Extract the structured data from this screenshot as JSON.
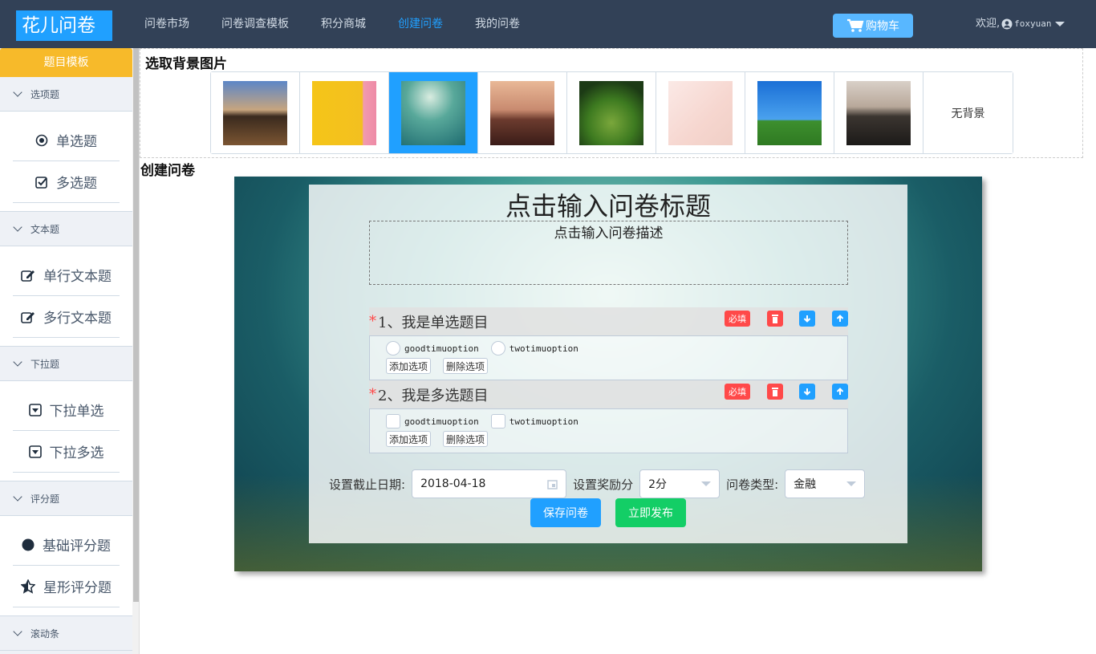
{
  "brand": "花儿问卷",
  "nav": [
    "问卷市场",
    "问卷调查模板",
    "积分商城",
    "创建问卷",
    "我的问卷"
  ],
  "nav_active": "创建问卷",
  "cart_label": "购物车",
  "welcome": "欢迎,",
  "username": "foxyuan",
  "sidebar": {
    "template_button": "题目模板",
    "groups": [
      {
        "title": "选项题",
        "items": [
          {
            "icon": "radio-icon",
            "label": "单选题"
          },
          {
            "icon": "checkbox-icon",
            "label": "多选题"
          }
        ]
      },
      {
        "title": "文本题",
        "items": [
          {
            "icon": "edit-icon",
            "label": "单行文本题"
          },
          {
            "icon": "edit-icon",
            "label": "多行文本题"
          }
        ]
      },
      {
        "title": "下拉题",
        "items": [
          {
            "icon": "dropdown-icon",
            "label": "下拉单选"
          },
          {
            "icon": "dropdown-icon",
            "label": "下拉多选"
          }
        ]
      },
      {
        "title": "评分题",
        "items": [
          {
            "icon": "circle-icon",
            "label": "基础评分题"
          },
          {
            "icon": "star-icon",
            "label": "星形评分题"
          }
        ]
      },
      {
        "title": "滚动条",
        "items": []
      }
    ]
  },
  "bg_section": {
    "heading": "选取背景图片",
    "selected_index": 2,
    "no_bg_label": "无背景"
  },
  "create_section": {
    "heading": "创建问卷",
    "title_placeholder": "点击输入问卷标题",
    "desc_placeholder": "点击输入问卷描述",
    "questions": [
      {
        "number": "1",
        "text": "1、我是单选题目",
        "type": "radio",
        "options": [
          "goodtimuoption",
          "twotimuoption"
        ]
      },
      {
        "number": "2",
        "text": "2、我是多选题目",
        "type": "checkbox",
        "options": [
          "goodtimuoption",
          "twotimuoption"
        ]
      }
    ],
    "required_label": "必填",
    "add_option_label": "添加选项",
    "delete_option_label": "删除选项",
    "deadline_label": "设置截止日期:",
    "deadline_value": "2018-04-18",
    "reward_label": "设置奖励分",
    "reward_value": "2分",
    "type_label": "问卷类型:",
    "type_value": "金融",
    "save_label": "保存问卷",
    "publish_label": "立即发布"
  },
  "colors": {
    "topbar": "#324157",
    "accent": "#20a0ff",
    "warning": "#f7ba2a",
    "danger": "#ff4949",
    "success": "#13ce66"
  }
}
